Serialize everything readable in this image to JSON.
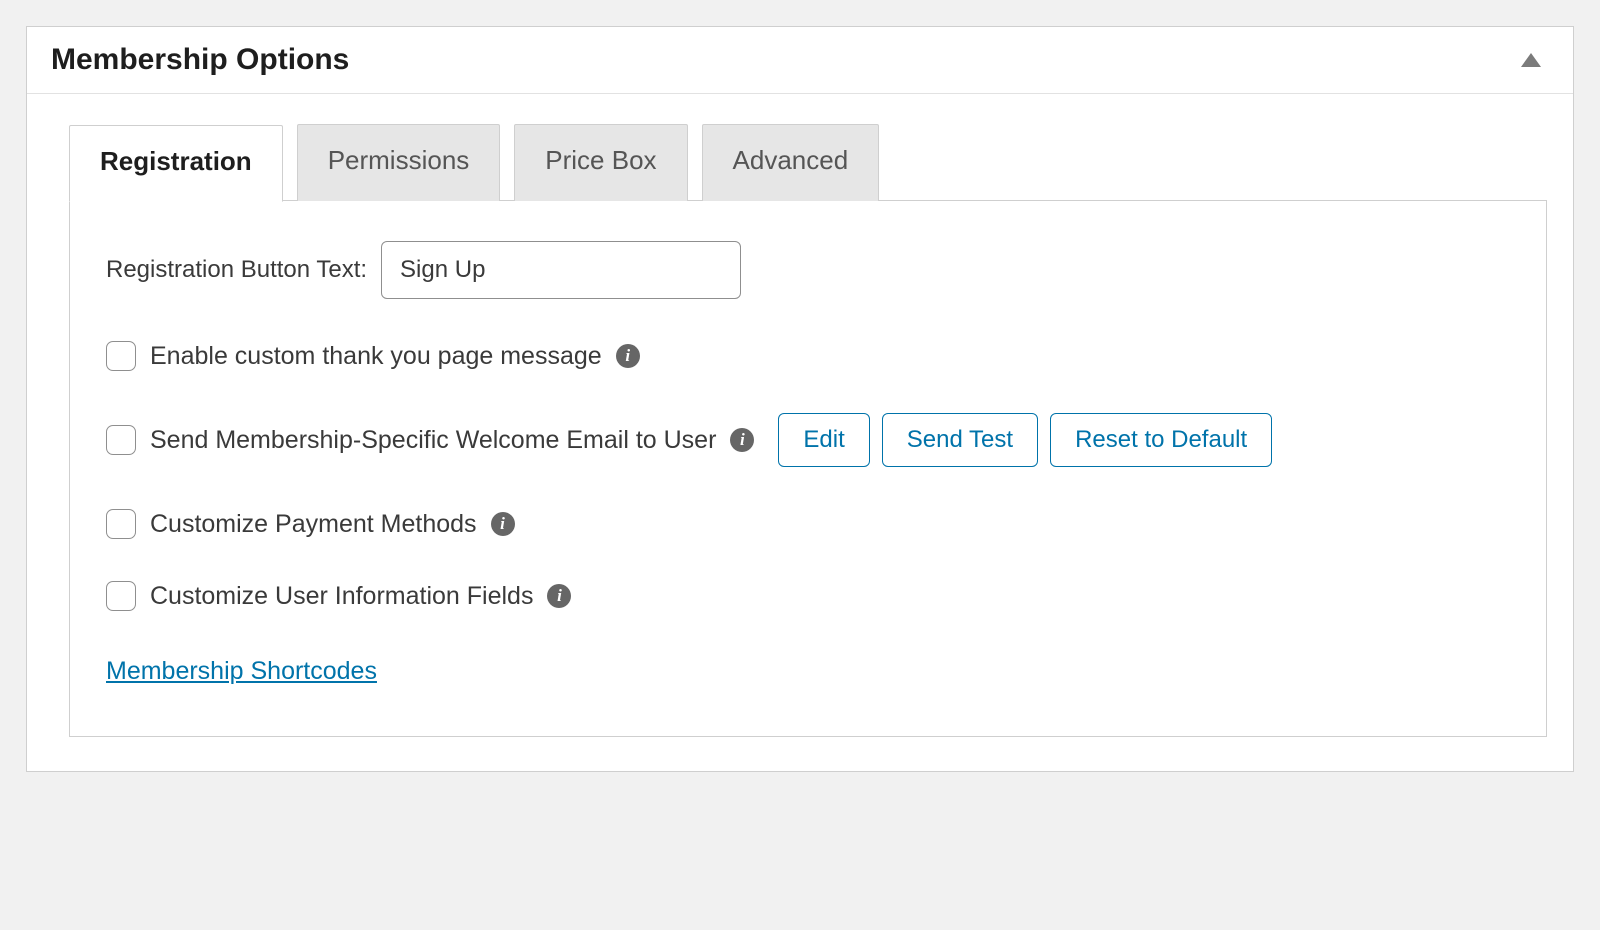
{
  "panel": {
    "title": "Membership Options"
  },
  "tabs": {
    "registration": "Registration",
    "permissions": "Permissions",
    "price_box": "Price Box",
    "advanced": "Advanced"
  },
  "registration": {
    "button_text_label": "Registration Button Text:",
    "button_text_value": "Sign Up",
    "thank_you_label": "Enable custom thank you page message",
    "welcome_email_label": "Send Membership-Specific Welcome Email to User",
    "welcome_email_buttons": {
      "edit": "Edit",
      "send_test": "Send Test",
      "reset": "Reset to Default"
    },
    "payment_methods_label": "Customize Payment Methods",
    "user_info_label": "Customize User Information Fields",
    "shortcodes_link": "Membership Shortcodes"
  }
}
